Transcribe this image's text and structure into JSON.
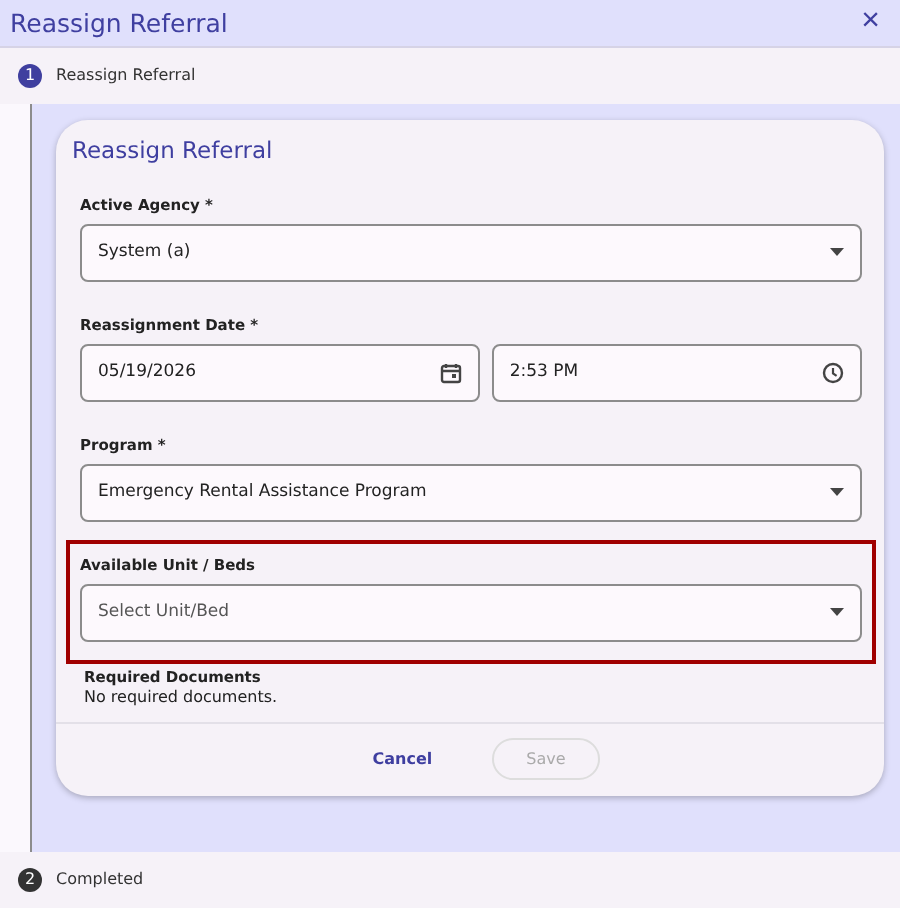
{
  "window": {
    "title": "Reassign Referral",
    "close": "×"
  },
  "steps": [
    {
      "number": "1",
      "label": "Reassign Referral",
      "selected": true
    },
    {
      "number": "2",
      "label": "Completed",
      "selected": false
    }
  ],
  "form": {
    "title": "Reassign Referral",
    "fields": [
      {
        "kind": "select",
        "label": "Active Agency *",
        "value": "System (a)",
        "highlighted": false
      },
      {
        "kind": "datetime",
        "label": "Reassignment Date *",
        "date": "05/19/2026",
        "time": "2:53 PM",
        "highlighted": false
      },
      {
        "kind": "select",
        "label": "Program *",
        "value": "Emergency Rental Assistance Program",
        "highlighted": false
      },
      {
        "kind": "select",
        "label": "Available Unit / Beds",
        "placeholder": "Select Unit/Bed",
        "highlighted": true
      }
    ],
    "documents": {
      "label": "Required Documents",
      "text": "No required documents."
    },
    "buttons": [
      {
        "label": "Cancel",
        "disabled": false,
        "kind": "text"
      },
      {
        "label": "Save",
        "disabled": true,
        "kind": "outlined"
      }
    ]
  }
}
